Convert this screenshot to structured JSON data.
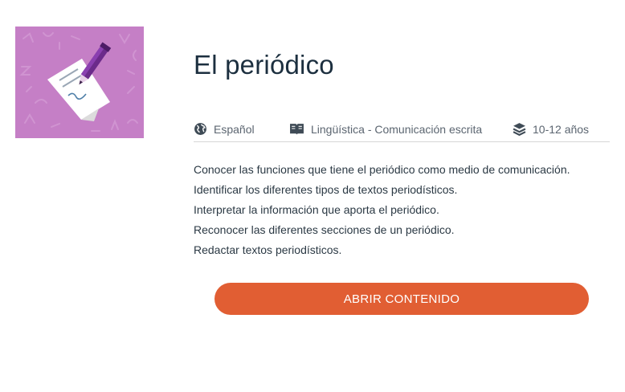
{
  "course": {
    "title": "El periódico",
    "thumbnail_icon": "document-pen-icon",
    "thumbnail_color": "#c57fc6"
  },
  "meta": {
    "language": {
      "icon": "globe-icon",
      "label": "Español"
    },
    "subject": {
      "icon": "book-icon",
      "label": "Lingüística - Comunicación escrita"
    },
    "age": {
      "icon": "layers-icon",
      "label": "10-12 años"
    }
  },
  "objectives": [
    "Conocer las funciones que tiene el periódico como medio de comunicación.",
    "Identificar los diferentes tipos de textos periodísticos.",
    "Interpretar la información que aporta el periódico.",
    "Reconocer las diferentes secciones de un periódico.",
    "Redactar textos periodísticos."
  ],
  "actions": {
    "open_label": "ABRIR CONTENIDO",
    "accent_color": "#e15e33"
  }
}
